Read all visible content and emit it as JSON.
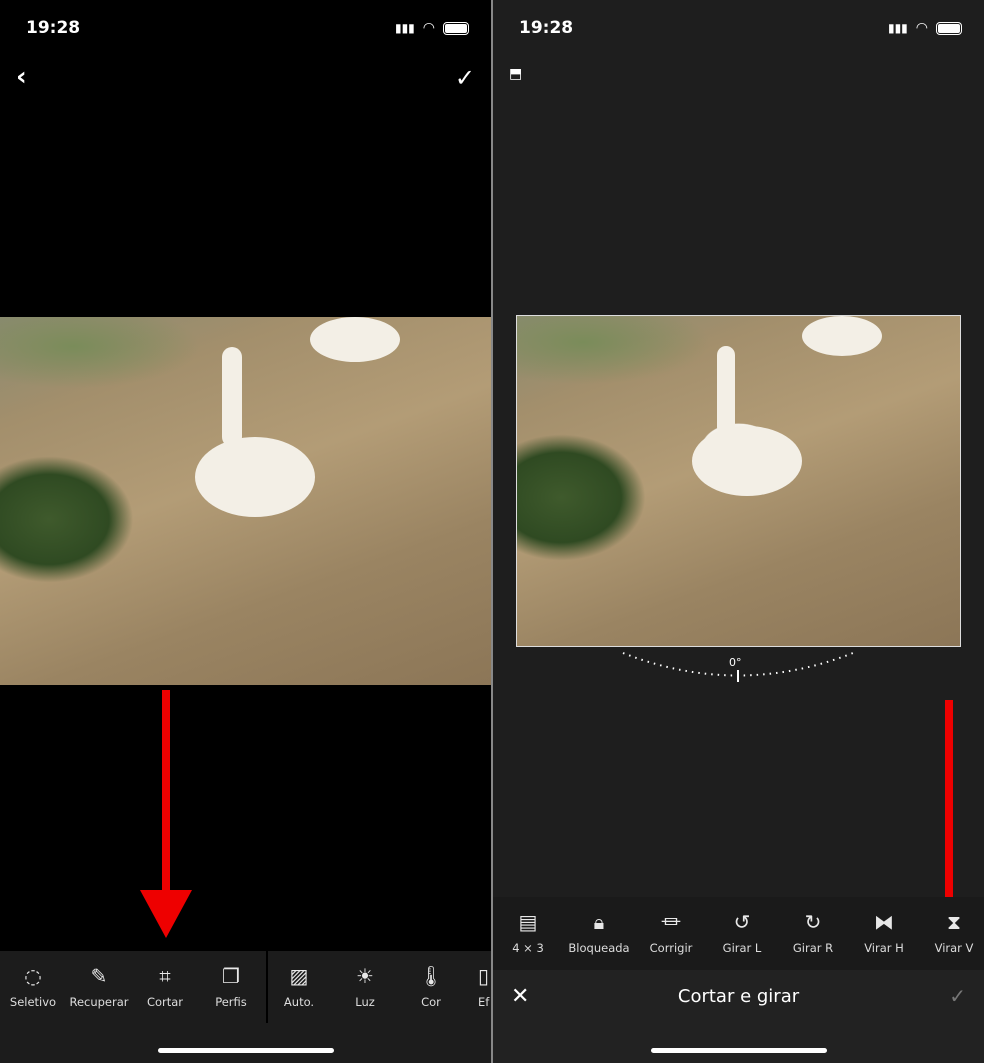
{
  "left": {
    "status": {
      "time": "19:28"
    },
    "header": {
      "back_icon": "chevron-left-icon",
      "confirm_icon": "checkmark-icon"
    },
    "toolbar": {
      "items": [
        {
          "label": "Seletivo",
          "icon": "selective-icon"
        },
        {
          "label": "Recuperar",
          "icon": "healing-icon"
        },
        {
          "label": "Cortar",
          "icon": "crop-icon"
        },
        {
          "label": "Perfis",
          "icon": "profiles-icon"
        },
        {
          "label": "Auto.",
          "icon": "auto-icon"
        },
        {
          "label": "Luz",
          "icon": "light-icon"
        },
        {
          "label": "Cor",
          "icon": "color-temperature-icon"
        },
        {
          "label": "Ef",
          "icon": "effects-icon"
        }
      ]
    }
  },
  "right": {
    "status": {
      "time": "19:28"
    },
    "rotation": {
      "label": "0°",
      "value": 0
    },
    "toolbar": {
      "items": [
        {
          "label": "4 × 3",
          "icon": "aspect-ratio-icon"
        },
        {
          "label": "Bloqueada",
          "icon": "lock-icon"
        },
        {
          "label": "Corrigir",
          "icon": "straighten-icon"
        },
        {
          "label": "Girar L",
          "icon": "rotate-left-icon"
        },
        {
          "label": "Girar R",
          "icon": "rotate-right-icon"
        },
        {
          "label": "Virar H",
          "icon": "flip-horizontal-icon"
        },
        {
          "label": "Virar V",
          "icon": "flip-vertical-icon"
        }
      ]
    },
    "footer": {
      "title": "Cortar e girar",
      "cancel_icon": "close-icon",
      "confirm_icon": "checkmark-icon"
    }
  },
  "colors": {
    "annotation_arrow": "#e00000",
    "panel_bg": "#1e1e1e"
  }
}
